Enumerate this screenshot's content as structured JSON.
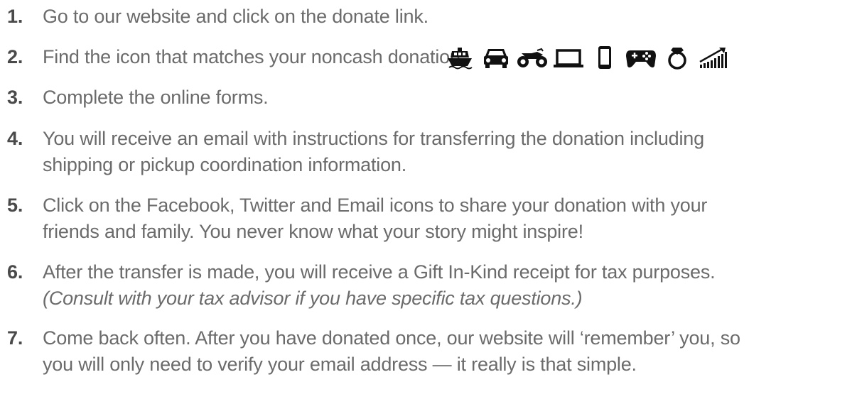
{
  "steps": [
    {
      "number": "1.",
      "lines": [
        "Go to our website and click on the donate link."
      ]
    },
    {
      "number": "2.",
      "lines": [
        "Find the icon that matches your noncash donation."
      ]
    },
    {
      "number": "3.",
      "lines": [
        "Complete the online forms."
      ]
    },
    {
      "number": "4.",
      "lines": [
        "You will receive an email with instructions for transferring the donation including",
        "shipping or pickup coordination information."
      ]
    },
    {
      "number": "5.",
      "lines": [
        "Click on the Facebook, Twitter and Email icons to share your donation with your",
        "friends and family. You never know what your story might inspire!"
      ]
    },
    {
      "number": "6.",
      "lines": [
        "After the transfer is made, you will receive a Gift In-Kind receipt for tax purposes."
      ],
      "note": "(Consult with your tax advisor if you have specific tax questions.)"
    },
    {
      "number": "7.",
      "lines": [
        "Come back often. After you have donated once, our website will ‘remember’ you, so",
        "you will only need to verify your email address — it really is that simple."
      ]
    }
  ],
  "donation_icons": [
    "boat-icon",
    "car-icon",
    "motorcycle-icon",
    "laptop-icon",
    "phone-icon",
    "gamepad-icon",
    "ring-icon",
    "stocks-icon"
  ],
  "colors": {
    "text": "#6b6b6b",
    "number": "#4a4a4a",
    "icon": "#111111"
  }
}
